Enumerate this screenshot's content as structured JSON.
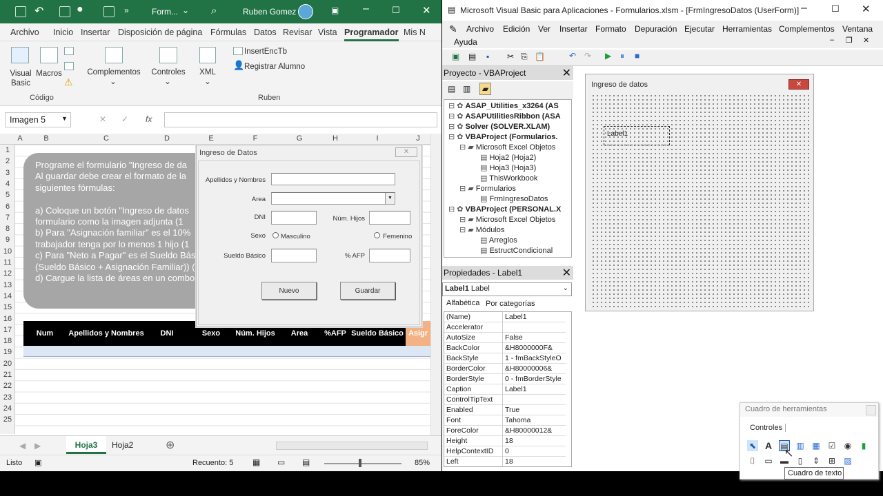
{
  "excel": {
    "title_file": "Form...",
    "user": "Ruben Gomez",
    "tabs": [
      "Archivo",
      "Inicio",
      "Insertar",
      "Disposición de página",
      "Fórmulas",
      "Datos",
      "Revisar",
      "Vista",
      "Programador",
      "Mis N"
    ],
    "ribbon": {
      "visual_basic": "Visual Basic",
      "macros": "Macros",
      "complementos": "Complementos",
      "controles": "Controles",
      "xml": "XML",
      "insert_enc": "InsertEncTb",
      "registrar": "Registrar Alumno",
      "group_codigo": "Código",
      "group_ruben": "Ruben"
    },
    "name_box": "Imagen 5",
    "fx": "fx",
    "columns": [
      "A",
      "B",
      "C",
      "D",
      "E",
      "F",
      "G",
      "H",
      "I",
      "J"
    ],
    "rows": [
      "1",
      "2",
      "3",
      "4",
      "5",
      "6",
      "7",
      "8",
      "9",
      "10",
      "11",
      "12",
      "13",
      "14",
      "15",
      "16",
      "17",
      "18",
      "19",
      "20",
      "21",
      "22",
      "23",
      "24",
      "25"
    ],
    "note_lines": [
      "Programe el formulario \"Ingreso de da",
      "Al guardar debe crear el formato de la",
      "siguientes fórmulas:",
      "",
      "a) Coloque un botón \"Ingreso de datos",
      "formulario como la imagen adjunta (1",
      "b) Para \"Asignación familiar\" es el 10%",
      "trabajador tenga por lo menos 1 hijo (1",
      "c) Para \"Neto a Pagar\" es el Sueldo Bás",
      "(Sueldo Básico + Asignación Familiar)) (",
      "d) Cargue la lista de áreas en un combo"
    ],
    "table_headers": [
      "Num",
      "Apellidos y Nombres",
      "DNI",
      "Sexo",
      "Núm. Hijos",
      "Area",
      "%AFP",
      "Sueldo Básico",
      "Asigr"
    ],
    "form": {
      "title": "Ingreso de Datos",
      "apellidos": "Apellidos y Nombres",
      "area": "Area",
      "dni": "DNI",
      "num_hijos": "Núm. Hijos",
      "sexo": "Sexo",
      "masculino": "Masculino",
      "femenino": "Femenino",
      "sueldo": "Sueldo Básico",
      "afp": "% AFP",
      "nuevo": "Nuevo",
      "guardar": "Guardar"
    },
    "sheet_tabs": [
      "Hoja3",
      "Hoja2"
    ],
    "status": {
      "ready": "Listo",
      "count": "Recuento: 5",
      "zoom": "85%"
    }
  },
  "vbe": {
    "title": "Microsoft Visual Basic para Aplicaciones - Formularios.xlsm - [FrmIngresoDatos (UserForm)]",
    "menu": [
      "Archivo",
      "Edición",
      "Ver",
      "Insertar",
      "Formato",
      "Depuración",
      "Ejecutar",
      "Herramientas",
      "Complementos",
      "Ventana",
      "Ayuda"
    ],
    "project_title": "Proyecto - VBAProject",
    "tree": [
      "ASAP_Utilities_x3264 (AS",
      "ASAPUtilitiesRibbon (ASA",
      "Solver (SOLVER.XLAM)",
      "VBAProject (Formularios.",
      "Microsoft Excel Objetos",
      "Hoja2 (Hoja2)",
      "Hoja3 (Hoja3)",
      "ThisWorkbook",
      "Formularios",
      "FrmIngresoDatos",
      "VBAProject (PERSONAL.X",
      "Microsoft Excel Objetos",
      "Módulos",
      "Arreglos",
      "EstructCondicional"
    ],
    "props_title": "Propiedades - Label1",
    "props_object": "Label1",
    "props_type": "Label",
    "props_tabs": [
      "Alfabética",
      "Por categorías"
    ],
    "properties": [
      [
        "(Name)",
        "Label1"
      ],
      [
        "Accelerator",
        ""
      ],
      [
        "AutoSize",
        "False"
      ],
      [
        "BackColor",
        "&H8000000F&"
      ],
      [
        "BackStyle",
        "1 - fmBackStyleO"
      ],
      [
        "BorderColor",
        "&H80000006&"
      ],
      [
        "BorderStyle",
        "0 - fmBorderStyle"
      ],
      [
        "Caption",
        "Label1"
      ],
      [
        "ControlTipText",
        ""
      ],
      [
        "Enabled",
        "True"
      ],
      [
        "Font",
        "Tahoma"
      ],
      [
        "ForeColor",
        "&H80000012&"
      ],
      [
        "Height",
        "18"
      ],
      [
        "HelpContextID",
        "0"
      ],
      [
        "Left",
        "18"
      ]
    ],
    "userform_title": "Ingreso de datos",
    "label_caption": "Label1",
    "toolbox_title": "Cuadro de herramientas",
    "toolbox_tab": "Controles",
    "tooltip": "Cuadro de texto"
  },
  "colors": {
    "excel_green": "#217346",
    "note_gray": "#a6a6a6",
    "header_black": "#000000",
    "asig_orange": "#f4b183"
  }
}
